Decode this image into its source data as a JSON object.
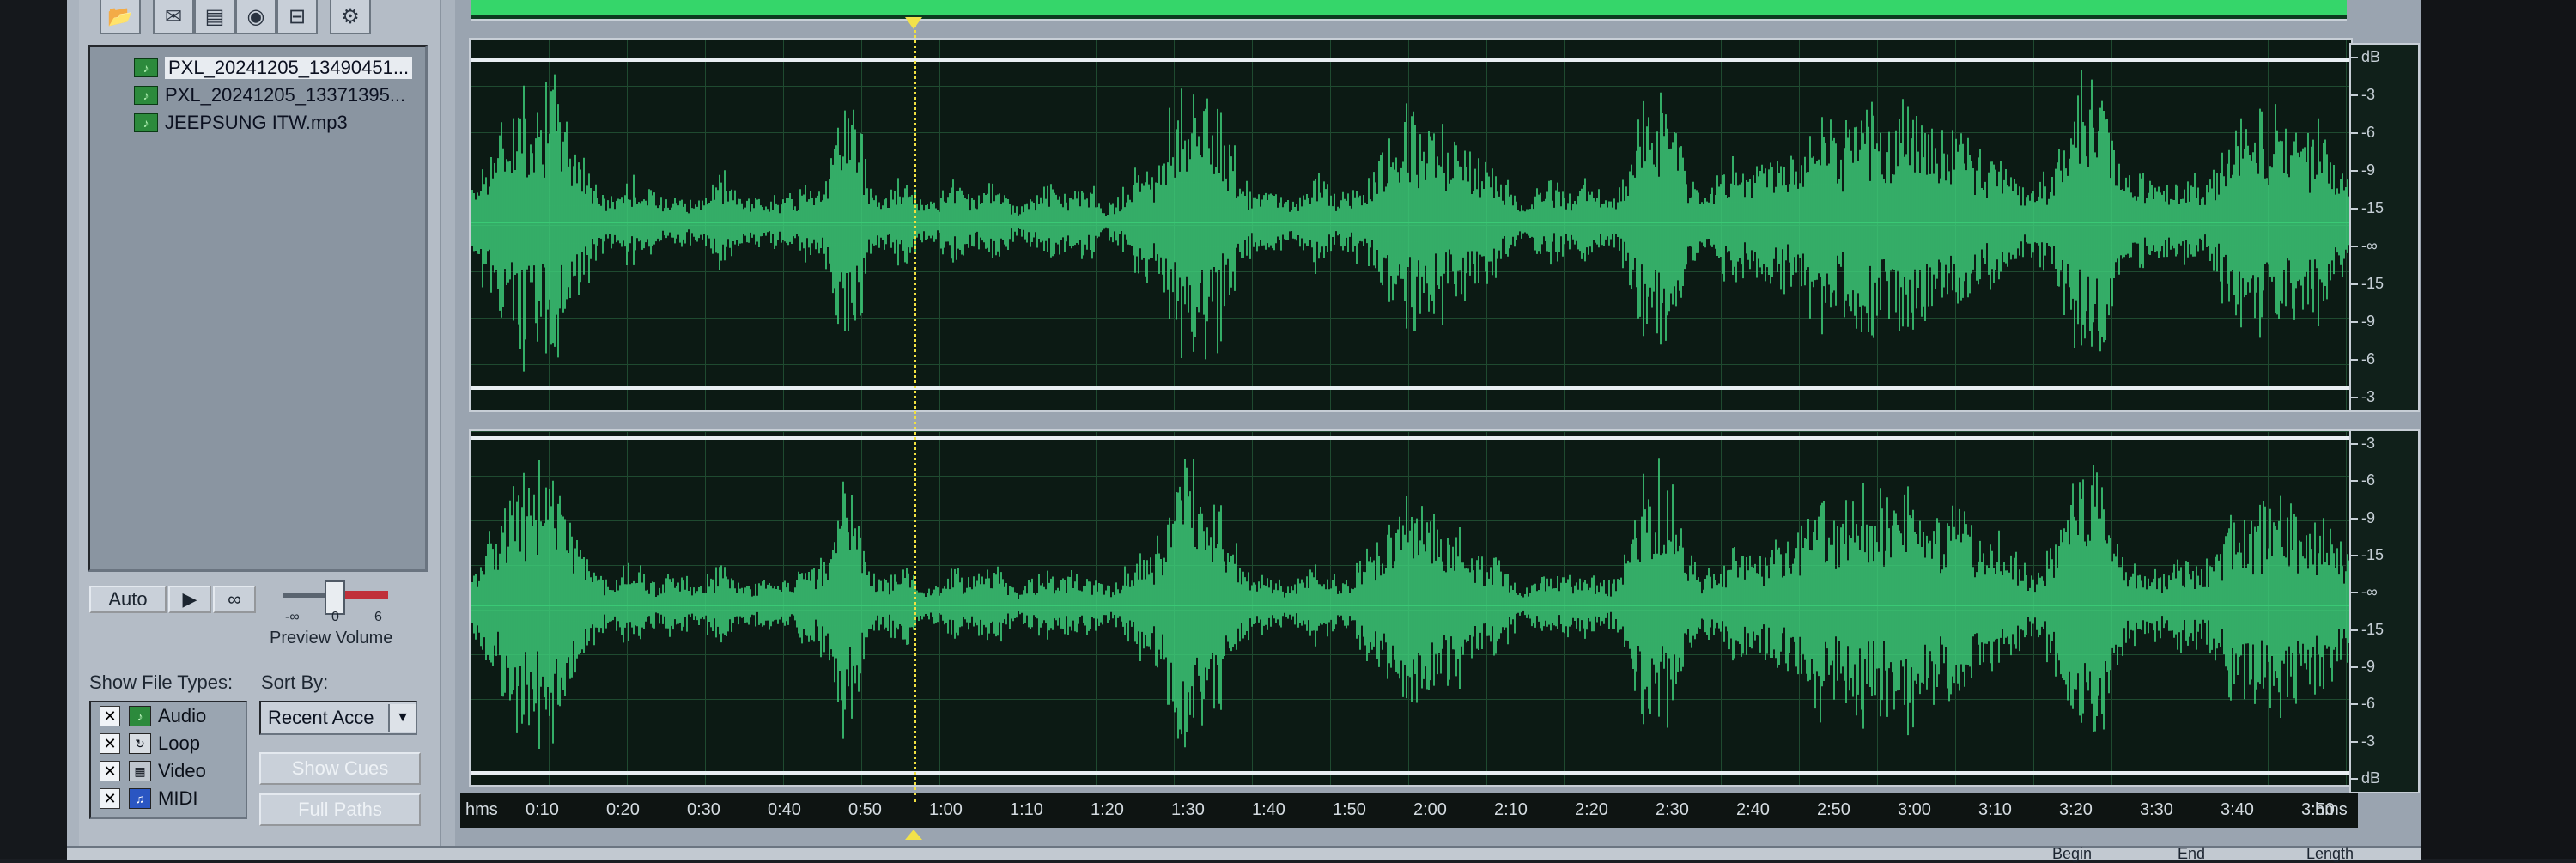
{
  "file_list": [
    {
      "name": "PXL_20241205_13490451...",
      "selected": true
    },
    {
      "name": "PXL_20241205_13371395...",
      "selected": false
    },
    {
      "name": "JEEPSUNG ITW.mp3",
      "selected": false
    }
  ],
  "preview": {
    "auto_label": "Auto",
    "play_label": "▶",
    "loop_label": "∞",
    "volume_label": "Preview Volume",
    "vol_min": "-∞",
    "vol_mid": "0",
    "vol_max": "6"
  },
  "filters": {
    "show_types_label": "Show File Types:",
    "sort_label": "Sort By:",
    "sort_value": "Recent Acce",
    "types": [
      {
        "label": "Audio",
        "icon": "audio-file-icon",
        "checked": true
      },
      {
        "label": "Loop",
        "icon": "loop-file-icon",
        "checked": true
      },
      {
        "label": "Video",
        "icon": "video-file-icon",
        "checked": true
      },
      {
        "label": "MIDI",
        "icon": "midi-file-icon",
        "checked": true
      }
    ],
    "show_cues_label": "Show Cues",
    "full_paths_label": "Full Paths"
  },
  "db_scale": {
    "top": [
      "dB",
      "-3",
      "-6",
      "-9",
      "-15",
      "-∞",
      "-15",
      "-9",
      "-6",
      "-3"
    ],
    "bottom": [
      "-3",
      "-6",
      "-9",
      "-15",
      "-∞",
      "-15",
      "-9",
      "-6",
      "-3",
      "dB"
    ]
  },
  "time_ruler": {
    "unit_left": "hms",
    "unit_right": "hms",
    "labels": [
      "0:10",
      "0:20",
      "0:30",
      "0:40",
      "0:50",
      "1:00",
      "1:10",
      "1:20",
      "1:30",
      "1:40",
      "1:50",
      "2:00",
      "2:10",
      "2:20",
      "2:30",
      "2:40",
      "2:50",
      "3:00",
      "3:10",
      "3:20",
      "3:30",
      "3:40",
      "3:50"
    ]
  },
  "status": {
    "begin": "Begin",
    "end": "End",
    "length": "Length"
  },
  "colors": {
    "waveform": "#3fd27c",
    "background": "#0c1a14",
    "cursor": "#f0e040"
  }
}
